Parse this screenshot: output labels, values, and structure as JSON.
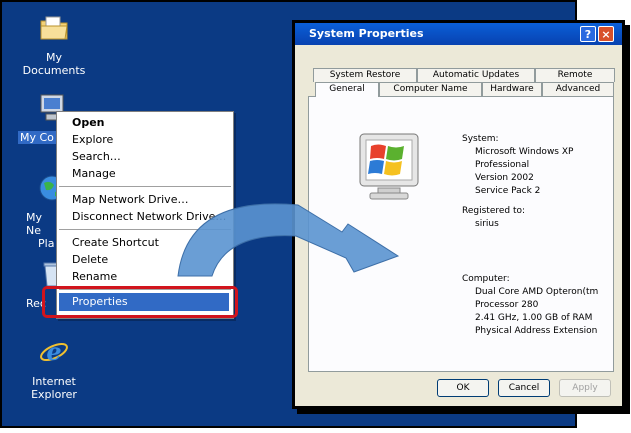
{
  "desktop": {
    "icons": [
      {
        "label_line1": "My Documents",
        "label_line2": ""
      },
      {
        "label_line1": "My Co",
        "label_line2": ""
      },
      {
        "label_line1": "My Ne",
        "label_line2": "Pla"
      },
      {
        "label_line1": "Rec",
        "label_line2": ""
      },
      {
        "label_line1": "Internet",
        "label_line2": "Explorer"
      }
    ]
  },
  "context_menu": {
    "items": [
      "Open",
      "Explore",
      "Search…",
      "Manage",
      "Map Network Drive…",
      "Disconnect Network Drive…",
      "Create Shortcut",
      "Delete",
      "Rename",
      "Properties"
    ]
  },
  "window": {
    "title": "System Properties",
    "help_glyph": "?",
    "close_glyph": "×",
    "tabs_back": [
      "System Restore",
      "Automatic Updates",
      "Remote"
    ],
    "tabs_front": [
      "General",
      "Computer Name",
      "Hardware",
      "Advanced"
    ],
    "system_heading": "System:",
    "system_lines": [
      "Microsoft Windows XP",
      "Professional",
      "Version 2002",
      "Service Pack 2"
    ],
    "registered_heading": "Registered to:",
    "registered_lines": [
      "sirius"
    ],
    "computer_heading": "Computer:",
    "computer_lines": [
      "Dual Core AMD Opteron(tm",
      "Processor 280",
      "2.41 GHz, 1.00 GB of RAM",
      "Physical Address Extension"
    ],
    "buttons": {
      "ok": "OK",
      "cancel": "Cancel",
      "apply": "Apply"
    }
  },
  "colors": {
    "desktop": "#0b3a84",
    "highlight": "#316ac5",
    "ring": "#d1141d",
    "arrow": "#5a94d0"
  }
}
